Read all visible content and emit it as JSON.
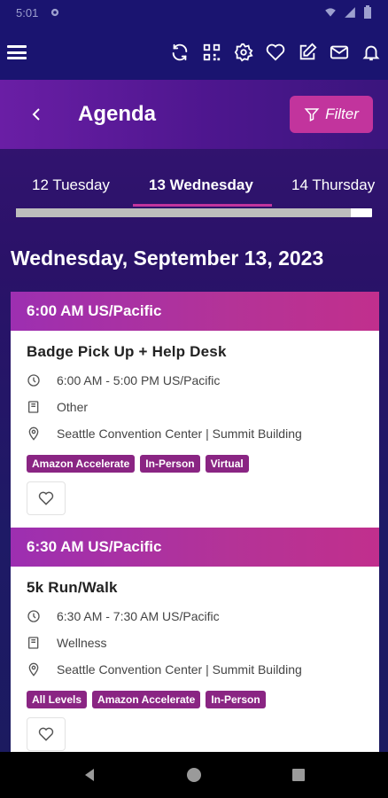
{
  "status_bar": {
    "time": "5:01",
    "icons": [
      "settings-icon",
      "wifi-icon",
      "signal-icon",
      "battery-icon"
    ]
  },
  "topbar": {
    "icons": [
      "menu-icon",
      "refresh-icon",
      "qr-code-icon",
      "gear-icon",
      "heart-icon",
      "edit-icon",
      "mail-icon",
      "bell-icon"
    ]
  },
  "header": {
    "title": "Agenda",
    "filter_label": "Filter",
    "colors": {
      "filter_bg": "#c2349d",
      "header_start": "#6a1ea5",
      "header_end": "#3a157d"
    }
  },
  "tabs": {
    "items": [
      {
        "label": "12 Tuesday"
      },
      {
        "label": "13 Wednesday",
        "selected": true
      },
      {
        "label": "14 Thursday"
      }
    ],
    "scroll_fraction": 0.94
  },
  "date_heading": "Wednesday, September 13, 2023",
  "sessions": [
    {
      "time_header": "6:00 AM US/Pacific",
      "title": "Badge Pick Up + Help Desk",
      "time": "6:00 AM - 5:00 PM US/Pacific",
      "category": "Other",
      "location": "Seattle Convention Center | Summit Building",
      "tags": [
        "Amazon Accelerate",
        "In-Person",
        "Virtual"
      ]
    },
    {
      "time_header": "6:30 AM US/Pacific",
      "title": "5k Run/Walk",
      "time": "6:30 AM - 7:30 AM US/Pacific",
      "category": "Wellness",
      "location": "Seattle Convention Center | Summit Building",
      "tags": [
        "All Levels",
        "Amazon Accelerate",
        "In-Person"
      ]
    }
  ],
  "colors": {
    "accent": "#c2349d",
    "chip": "#8a2583",
    "background": "#2a1268"
  }
}
